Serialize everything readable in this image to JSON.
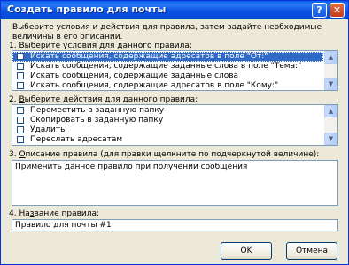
{
  "window": {
    "title": "Создать правило для почты",
    "help_label": "?",
    "close_label": "✕"
  },
  "intro": "Выберите условия и действия для правила, затем задайте необходимые величины в его описании.",
  "conditions": {
    "label_num": "1. ",
    "label_u": "В",
    "label_rest": "ыберите условия для данного правила:",
    "items": [
      {
        "text": "Искать сообщения, содержащие адресатов в поле \"От:\"",
        "checked": false,
        "selected": true
      },
      {
        "text": "Искать сообщения, содержащие заданные слова в поле \"Тема:\"",
        "checked": false,
        "selected": false
      },
      {
        "text": "Искать сообщения, содержащие заданные слова",
        "checked": false,
        "selected": false
      },
      {
        "text": "Искать сообщения, содержащие адресатов в поле \"Кому:\"",
        "checked": false,
        "selected": false
      }
    ]
  },
  "actions": {
    "label_num": "2. ",
    "label_u": "В",
    "label_rest": "ыберите действия для данного правила:",
    "items": [
      {
        "text": "Переместить в заданную папку",
        "checked": false
      },
      {
        "text": "Скопировать в заданную папку",
        "checked": false
      },
      {
        "text": "Удалить",
        "checked": false
      },
      {
        "text": "Переслать адресатам",
        "checked": false
      }
    ]
  },
  "description": {
    "label_num": "3. ",
    "label_u": "О",
    "label_rest": "писание правила (для правки щелкните по подчеркнутой величине):",
    "text": "Применить данное правило при получении сообщения"
  },
  "rule_name": {
    "label_pre": "4. На",
    "label_u": "з",
    "label_rest": "вание правила:",
    "value": "Правило для почты #1"
  },
  "buttons": {
    "ok": "OK",
    "cancel": "Отмена"
  },
  "scroll": {
    "up_glyph": "▲",
    "down_glyph": "▼"
  }
}
